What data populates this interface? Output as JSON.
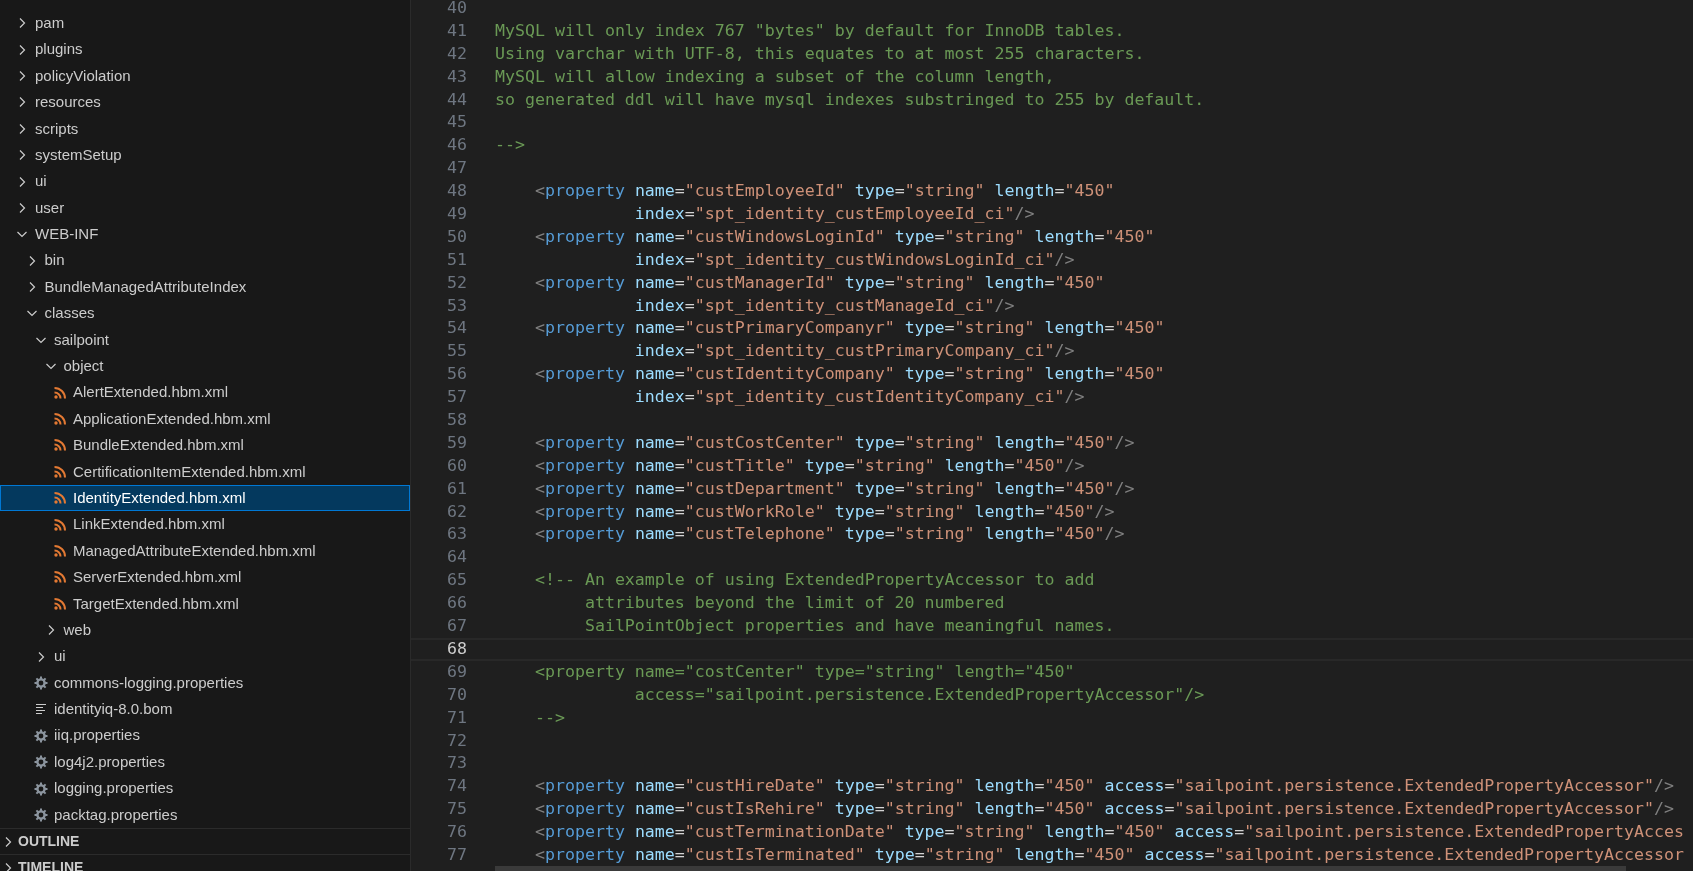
{
  "explorer": {
    "items": [
      {
        "label": "pam",
        "kind": "folder",
        "expanded": false,
        "selected": false
      },
      {
        "label": "plugins",
        "kind": "folder",
        "expanded": false,
        "selected": false
      },
      {
        "label": "policyViolation",
        "kind": "folder",
        "expanded": false,
        "selected": false
      },
      {
        "label": "resources",
        "kind": "folder",
        "expanded": false,
        "selected": false
      },
      {
        "label": "scripts",
        "kind": "folder",
        "expanded": false,
        "selected": false
      },
      {
        "label": "systemSetup",
        "kind": "folder",
        "expanded": false,
        "selected": false
      },
      {
        "label": "ui",
        "kind": "folder",
        "expanded": false,
        "selected": false
      },
      {
        "label": "user",
        "kind": "folder",
        "expanded": false,
        "selected": false
      },
      {
        "label": "WEB-INF",
        "kind": "folder",
        "expanded": true,
        "selected": false,
        "children": [
          {
            "label": "bin",
            "kind": "folder",
            "expanded": false,
            "selected": false
          },
          {
            "label": "BundleManagedAttributeIndex",
            "kind": "folder",
            "expanded": false,
            "selected": false
          },
          {
            "label": "classes",
            "kind": "folder",
            "expanded": true,
            "selected": false,
            "children": [
              {
                "label": "sailpoint",
                "kind": "folder",
                "expanded": true,
                "selected": false,
                "children": [
                  {
                    "label": "object",
                    "kind": "folder",
                    "expanded": true,
                    "selected": false,
                    "children": [
                      {
                        "label": "AlertExtended.hbm.xml",
                        "kind": "xml",
                        "selected": false
                      },
                      {
                        "label": "ApplicationExtended.hbm.xml",
                        "kind": "xml",
                        "selected": false
                      },
                      {
                        "label": "BundleExtended.hbm.xml",
                        "kind": "xml",
                        "selected": false
                      },
                      {
                        "label": "CertificationItemExtended.hbm.xml",
                        "kind": "xml",
                        "selected": false
                      },
                      {
                        "label": "IdentityExtended.hbm.xml",
                        "kind": "xml",
                        "selected": true
                      },
                      {
                        "label": "LinkExtended.hbm.xml",
                        "kind": "xml",
                        "selected": false
                      },
                      {
                        "label": "ManagedAttributeExtended.hbm.xml",
                        "kind": "xml",
                        "selected": false
                      },
                      {
                        "label": "ServerExtended.hbm.xml",
                        "kind": "xml",
                        "selected": false
                      },
                      {
                        "label": "TargetExtended.hbm.xml",
                        "kind": "xml",
                        "selected": false
                      }
                    ]
                  },
                  {
                    "label": "web",
                    "kind": "folder",
                    "expanded": false,
                    "selected": false
                  }
                ]
              },
              {
                "label": "ui",
                "kind": "folder",
                "expanded": false,
                "selected": false
              },
              {
                "label": "commons-logging.properties",
                "kind": "settings",
                "selected": false
              },
              {
                "label": "identityiq-8.0.bom",
                "kind": "text",
                "selected": false
              },
              {
                "label": "iiq.properties",
                "kind": "settings",
                "selected": false
              },
              {
                "label": "log4j2.properties",
                "kind": "settings",
                "selected": false
              },
              {
                "label": "logging.properties",
                "kind": "settings",
                "selected": false
              },
              {
                "label": "packtag.properties",
                "kind": "settings",
                "selected": false
              }
            ]
          }
        ]
      }
    ],
    "panels": [
      {
        "title": "OUTLINE",
        "expanded": false
      },
      {
        "title": "TIMELINE",
        "expanded": false
      }
    ]
  },
  "editor": {
    "lines": [
      {
        "number": "40",
        "current": false
      },
      {
        "number": "41",
        "current": false,
        "tokens": [
          {
            "kind": "comment",
            "text": "MySQL will only index 767 \"bytes\" by default for InnoDB tables."
          }
        ]
      },
      {
        "number": "42",
        "current": false,
        "tokens": [
          {
            "kind": "comment",
            "text": "Using varchar with UTF-8, this equates to at most 255 characters."
          }
        ]
      },
      {
        "number": "43",
        "current": false,
        "tokens": [
          {
            "kind": "comment",
            "text": "MySQL will allow indexing a subset of the column length,"
          }
        ]
      },
      {
        "number": "44",
        "current": false,
        "tokens": [
          {
            "kind": "comment",
            "text": "so generated ddl will have mysql indexes substringed to 255 by default."
          }
        ]
      },
      {
        "number": "45",
        "current": false
      },
      {
        "number": "46",
        "current": false,
        "tokens": [
          {
            "kind": "comment",
            "text": "-->"
          }
        ]
      },
      {
        "number": "47",
        "current": false
      },
      {
        "number": "48",
        "current": false,
        "tokens": [
          {
            "kind": "punct",
            "text": "    <"
          },
          {
            "kind": "tag",
            "text": "property"
          },
          {
            "kind": "attr",
            "text": " name"
          },
          {
            "kind": "eq",
            "text": "="
          },
          {
            "kind": "string",
            "text": "\"custEmployeeId\""
          },
          {
            "kind": "attr",
            "text": " type"
          },
          {
            "kind": "eq",
            "text": "="
          },
          {
            "kind": "string",
            "text": "\"string\""
          },
          {
            "kind": "attr",
            "text": " length"
          },
          {
            "kind": "eq",
            "text": "="
          },
          {
            "kind": "string",
            "text": "\"450\""
          }
        ]
      },
      {
        "number": "49",
        "current": false,
        "tokens": [
          {
            "kind": "attr",
            "text": "              index"
          },
          {
            "kind": "eq",
            "text": "="
          },
          {
            "kind": "string",
            "text": "\"spt_identity_custEmployeeId_ci\""
          },
          {
            "kind": "punct",
            "text": "/>"
          }
        ]
      },
      {
        "number": "50",
        "current": false,
        "tokens": [
          {
            "kind": "punct",
            "text": "    <"
          },
          {
            "kind": "tag",
            "text": "property"
          },
          {
            "kind": "attr",
            "text": " name"
          },
          {
            "kind": "eq",
            "text": "="
          },
          {
            "kind": "string",
            "text": "\"custWindowsLoginId\""
          },
          {
            "kind": "attr",
            "text": " type"
          },
          {
            "kind": "eq",
            "text": "="
          },
          {
            "kind": "string",
            "text": "\"string\""
          },
          {
            "kind": "attr",
            "text": " length"
          },
          {
            "kind": "eq",
            "text": "="
          },
          {
            "kind": "string",
            "text": "\"450\""
          }
        ]
      },
      {
        "number": "51",
        "current": false,
        "tokens": [
          {
            "kind": "attr",
            "text": "              index"
          },
          {
            "kind": "eq",
            "text": "="
          },
          {
            "kind": "string",
            "text": "\"spt_identity_custWindowsLoginId_ci\""
          },
          {
            "kind": "punct",
            "text": "/>"
          }
        ]
      },
      {
        "number": "52",
        "current": false,
        "tokens": [
          {
            "kind": "punct",
            "text": "    <"
          },
          {
            "kind": "tag",
            "text": "property"
          },
          {
            "kind": "attr",
            "text": " name"
          },
          {
            "kind": "eq",
            "text": "="
          },
          {
            "kind": "string",
            "text": "\"custManagerId\""
          },
          {
            "kind": "attr",
            "text": " type"
          },
          {
            "kind": "eq",
            "text": "="
          },
          {
            "kind": "string",
            "text": "\"string\""
          },
          {
            "kind": "attr",
            "text": " length"
          },
          {
            "kind": "eq",
            "text": "="
          },
          {
            "kind": "string",
            "text": "\"450\""
          }
        ]
      },
      {
        "number": "53",
        "current": false,
        "tokens": [
          {
            "kind": "attr",
            "text": "              index"
          },
          {
            "kind": "eq",
            "text": "="
          },
          {
            "kind": "string",
            "text": "\"spt_identity_custManageId_ci\""
          },
          {
            "kind": "punct",
            "text": "/>"
          }
        ]
      },
      {
        "number": "54",
        "current": false,
        "tokens": [
          {
            "kind": "punct",
            "text": "    <"
          },
          {
            "kind": "tag",
            "text": "property"
          },
          {
            "kind": "attr",
            "text": " name"
          },
          {
            "kind": "eq",
            "text": "="
          },
          {
            "kind": "string",
            "text": "\"custPrimaryCompanyr\""
          },
          {
            "kind": "attr",
            "text": " type"
          },
          {
            "kind": "eq",
            "text": "="
          },
          {
            "kind": "string",
            "text": "\"string\""
          },
          {
            "kind": "attr",
            "text": " length"
          },
          {
            "kind": "eq",
            "text": "="
          },
          {
            "kind": "string",
            "text": "\"450\""
          }
        ]
      },
      {
        "number": "55",
        "current": false,
        "tokens": [
          {
            "kind": "attr",
            "text": "              index"
          },
          {
            "kind": "eq",
            "text": "="
          },
          {
            "kind": "string",
            "text": "\"spt_identity_custPrimaryCompany_ci\""
          },
          {
            "kind": "punct",
            "text": "/>"
          }
        ]
      },
      {
        "number": "56",
        "current": false,
        "tokens": [
          {
            "kind": "punct",
            "text": "    <"
          },
          {
            "kind": "tag",
            "text": "property"
          },
          {
            "kind": "attr",
            "text": " name"
          },
          {
            "kind": "eq",
            "text": "="
          },
          {
            "kind": "string",
            "text": "\"custIdentityCompany\""
          },
          {
            "kind": "attr",
            "text": " type"
          },
          {
            "kind": "eq",
            "text": "="
          },
          {
            "kind": "string",
            "text": "\"string\""
          },
          {
            "kind": "attr",
            "text": " length"
          },
          {
            "kind": "eq",
            "text": "="
          },
          {
            "kind": "string",
            "text": "\"450\""
          }
        ]
      },
      {
        "number": "57",
        "current": false,
        "tokens": [
          {
            "kind": "attr",
            "text": "              index"
          },
          {
            "kind": "eq",
            "text": "="
          },
          {
            "kind": "string",
            "text": "\"spt_identity_custIdentityCompany_ci\""
          },
          {
            "kind": "punct",
            "text": "/>"
          }
        ]
      },
      {
        "number": "58",
        "current": false
      },
      {
        "number": "59",
        "current": false,
        "tokens": [
          {
            "kind": "punct",
            "text": "    <"
          },
          {
            "kind": "tag",
            "text": "property"
          },
          {
            "kind": "attr",
            "text": " name"
          },
          {
            "kind": "eq",
            "text": "="
          },
          {
            "kind": "string",
            "text": "\"custCostCenter\""
          },
          {
            "kind": "attr",
            "text": " type"
          },
          {
            "kind": "eq",
            "text": "="
          },
          {
            "kind": "string",
            "text": "\"string\""
          },
          {
            "kind": "attr",
            "text": " length"
          },
          {
            "kind": "eq",
            "text": "="
          },
          {
            "kind": "string",
            "text": "\"450\""
          },
          {
            "kind": "punct",
            "text": "/>"
          }
        ]
      },
      {
        "number": "60",
        "current": false,
        "tokens": [
          {
            "kind": "punct",
            "text": "    <"
          },
          {
            "kind": "tag",
            "text": "property"
          },
          {
            "kind": "attr",
            "text": " name"
          },
          {
            "kind": "eq",
            "text": "="
          },
          {
            "kind": "string",
            "text": "\"custTitle\""
          },
          {
            "kind": "attr",
            "text": " type"
          },
          {
            "kind": "eq",
            "text": "="
          },
          {
            "kind": "string",
            "text": "\"string\""
          },
          {
            "kind": "attr",
            "text": " length"
          },
          {
            "kind": "eq",
            "text": "="
          },
          {
            "kind": "string",
            "text": "\"450\""
          },
          {
            "kind": "punct",
            "text": "/>"
          }
        ]
      },
      {
        "number": "61",
        "current": false,
        "tokens": [
          {
            "kind": "punct",
            "text": "    <"
          },
          {
            "kind": "tag",
            "text": "property"
          },
          {
            "kind": "attr",
            "text": " name"
          },
          {
            "kind": "eq",
            "text": "="
          },
          {
            "kind": "string",
            "text": "\"custDepartment\""
          },
          {
            "kind": "attr",
            "text": " type"
          },
          {
            "kind": "eq",
            "text": "="
          },
          {
            "kind": "string",
            "text": "\"string\""
          },
          {
            "kind": "attr",
            "text": " length"
          },
          {
            "kind": "eq",
            "text": "="
          },
          {
            "kind": "string",
            "text": "\"450\""
          },
          {
            "kind": "punct",
            "text": "/>"
          }
        ]
      },
      {
        "number": "62",
        "current": false,
        "tokens": [
          {
            "kind": "punct",
            "text": "    <"
          },
          {
            "kind": "tag",
            "text": "property"
          },
          {
            "kind": "attr",
            "text": " name"
          },
          {
            "kind": "eq",
            "text": "="
          },
          {
            "kind": "string",
            "text": "\"custWorkRole\""
          },
          {
            "kind": "attr",
            "text": " type"
          },
          {
            "kind": "eq",
            "text": "="
          },
          {
            "kind": "string",
            "text": "\"string\""
          },
          {
            "kind": "attr",
            "text": " length"
          },
          {
            "kind": "eq",
            "text": "="
          },
          {
            "kind": "string",
            "text": "\"450\""
          },
          {
            "kind": "punct",
            "text": "/>"
          }
        ]
      },
      {
        "number": "63",
        "current": false,
        "tokens": [
          {
            "kind": "punct",
            "text": "    <"
          },
          {
            "kind": "tag",
            "text": "property"
          },
          {
            "kind": "attr",
            "text": " name"
          },
          {
            "kind": "eq",
            "text": "="
          },
          {
            "kind": "string",
            "text": "\"custTelephone\""
          },
          {
            "kind": "attr",
            "text": " type"
          },
          {
            "kind": "eq",
            "text": "="
          },
          {
            "kind": "string",
            "text": "\"string\""
          },
          {
            "kind": "attr",
            "text": " length"
          },
          {
            "kind": "eq",
            "text": "="
          },
          {
            "kind": "string",
            "text": "\"450\""
          },
          {
            "kind": "punct",
            "text": "/>"
          }
        ]
      },
      {
        "number": "64",
        "current": false
      },
      {
        "number": "65",
        "current": false,
        "tokens": [
          {
            "kind": "comment",
            "text": "    <!-- An example of using ExtendedPropertyAccessor to add"
          }
        ]
      },
      {
        "number": "66",
        "current": false,
        "tokens": [
          {
            "kind": "comment",
            "text": "         attributes beyond the limit of 20 numbered"
          }
        ]
      },
      {
        "number": "67",
        "current": false,
        "tokens": [
          {
            "kind": "comment",
            "text": "         SailPointObject properties and have meaningful names."
          }
        ]
      },
      {
        "number": "68",
        "current": true
      },
      {
        "number": "69",
        "current": false,
        "tokens": [
          {
            "kind": "comment",
            "text": "    <property name=\"costCenter\" type=\"string\" length=\"450\""
          }
        ]
      },
      {
        "number": "70",
        "current": false,
        "tokens": [
          {
            "kind": "comment",
            "text": "              access=\"sailpoint.persistence.ExtendedPropertyAccessor\"/>"
          }
        ]
      },
      {
        "number": "71",
        "current": false,
        "tokens": [
          {
            "kind": "comment",
            "text": "    -->"
          }
        ]
      },
      {
        "number": "72",
        "current": false
      },
      {
        "number": "73",
        "current": false
      },
      {
        "number": "74",
        "current": false,
        "tokens": [
          {
            "kind": "punct",
            "text": "    <"
          },
          {
            "kind": "tag",
            "text": "property"
          },
          {
            "kind": "attr",
            "text": " name"
          },
          {
            "kind": "eq",
            "text": "="
          },
          {
            "kind": "string",
            "text": "\"custHireDate\""
          },
          {
            "kind": "attr",
            "text": " type"
          },
          {
            "kind": "eq",
            "text": "="
          },
          {
            "kind": "string",
            "text": "\"string\""
          },
          {
            "kind": "attr",
            "text": " length"
          },
          {
            "kind": "eq",
            "text": "="
          },
          {
            "kind": "string",
            "text": "\"450\""
          },
          {
            "kind": "attr",
            "text": " access"
          },
          {
            "kind": "eq",
            "text": "="
          },
          {
            "kind": "string",
            "text": "\"sailpoint.persistence.ExtendedPropertyAccessor\""
          },
          {
            "kind": "punct",
            "text": "/>"
          }
        ]
      },
      {
        "number": "75",
        "current": false,
        "tokens": [
          {
            "kind": "punct",
            "text": "    <"
          },
          {
            "kind": "tag",
            "text": "property"
          },
          {
            "kind": "attr",
            "text": " name"
          },
          {
            "kind": "eq",
            "text": "="
          },
          {
            "kind": "string",
            "text": "\"custIsRehire\""
          },
          {
            "kind": "attr",
            "text": " type"
          },
          {
            "kind": "eq",
            "text": "="
          },
          {
            "kind": "string",
            "text": "\"string\""
          },
          {
            "kind": "attr",
            "text": " length"
          },
          {
            "kind": "eq",
            "text": "="
          },
          {
            "kind": "string",
            "text": "\"450\""
          },
          {
            "kind": "attr",
            "text": " access"
          },
          {
            "kind": "eq",
            "text": "="
          },
          {
            "kind": "string",
            "text": "\"sailpoint.persistence.ExtendedPropertyAccessor\""
          },
          {
            "kind": "punct",
            "text": "/>"
          }
        ]
      },
      {
        "number": "76",
        "current": false,
        "tokens": [
          {
            "kind": "punct",
            "text": "    <"
          },
          {
            "kind": "tag",
            "text": "property"
          },
          {
            "kind": "attr",
            "text": " name"
          },
          {
            "kind": "eq",
            "text": "="
          },
          {
            "kind": "string",
            "text": "\"custTerminationDate\""
          },
          {
            "kind": "attr",
            "text": " type"
          },
          {
            "kind": "eq",
            "text": "="
          },
          {
            "kind": "string",
            "text": "\"string\""
          },
          {
            "kind": "attr",
            "text": " length"
          },
          {
            "kind": "eq",
            "text": "="
          },
          {
            "kind": "string",
            "text": "\"450\""
          },
          {
            "kind": "attr",
            "text": " access"
          },
          {
            "kind": "eq",
            "text": "="
          },
          {
            "kind": "string",
            "text": "\"sailpoint.persistence.ExtendedPropertyAcces"
          }
        ]
      },
      {
        "number": "77",
        "current": false,
        "tokens": [
          {
            "kind": "punct",
            "text": "    <"
          },
          {
            "kind": "tag",
            "text": "property"
          },
          {
            "kind": "attr",
            "text": " name"
          },
          {
            "kind": "eq",
            "text": "="
          },
          {
            "kind": "string",
            "text": "\"custIsTerminated\""
          },
          {
            "kind": "attr",
            "text": " type"
          },
          {
            "kind": "eq",
            "text": "="
          },
          {
            "kind": "string",
            "text": "\"string\""
          },
          {
            "kind": "attr",
            "text": " length"
          },
          {
            "kind": "eq",
            "text": "="
          },
          {
            "kind": "string",
            "text": "\"450\""
          },
          {
            "kind": "attr",
            "text": " access"
          },
          {
            "kind": "eq",
            "text": "="
          },
          {
            "kind": "string",
            "text": "\"sailpoint.persistence.ExtendedPropertyAccessor"
          }
        ]
      }
    ]
  }
}
